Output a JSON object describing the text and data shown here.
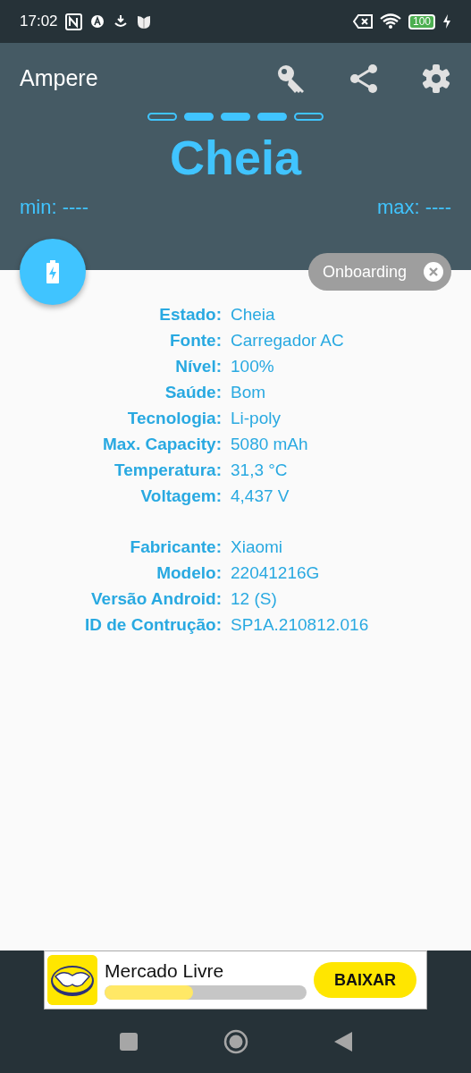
{
  "status_bar": {
    "time": "17:02",
    "battery": "100"
  },
  "app_bar": {
    "title": "Ampere"
  },
  "page_indicator": [
    {
      "filled": false
    },
    {
      "filled": true
    },
    {
      "filled": true
    },
    {
      "filled": true
    },
    {
      "filled": false
    }
  ],
  "state": "Cheia",
  "min": "min: ----",
  "max": "max: ----",
  "chip": {
    "label": "Onboarding"
  },
  "info_groups": [
    [
      {
        "label": "Estado:",
        "value": "Cheia"
      },
      {
        "label": "Fonte:",
        "value": "Carregador AC"
      },
      {
        "label": "Nível:",
        "value": "100%"
      },
      {
        "label": "Saúde:",
        "value": "Bom"
      },
      {
        "label": "Tecnologia:",
        "value": "Li-poly"
      },
      {
        "label": "Max. Capacity:",
        "value": "5080 mAh"
      },
      {
        "label": "Temperatura:",
        "value": "31,3 °C"
      },
      {
        "label": "Voltagem:",
        "value": "4,437 V"
      }
    ],
    [
      {
        "label": "Fabricante:",
        "value": "Xiaomi"
      },
      {
        "label": "Modelo:",
        "value": "22041216G"
      },
      {
        "label": "Versão Android:",
        "value": "12 (S)"
      },
      {
        "label": "ID de Contrução:",
        "value": "SP1A.210812.016"
      }
    ]
  ],
  "ad": {
    "title": "Mercado Livre",
    "level": 0.44,
    "button": "BAIXAR"
  }
}
